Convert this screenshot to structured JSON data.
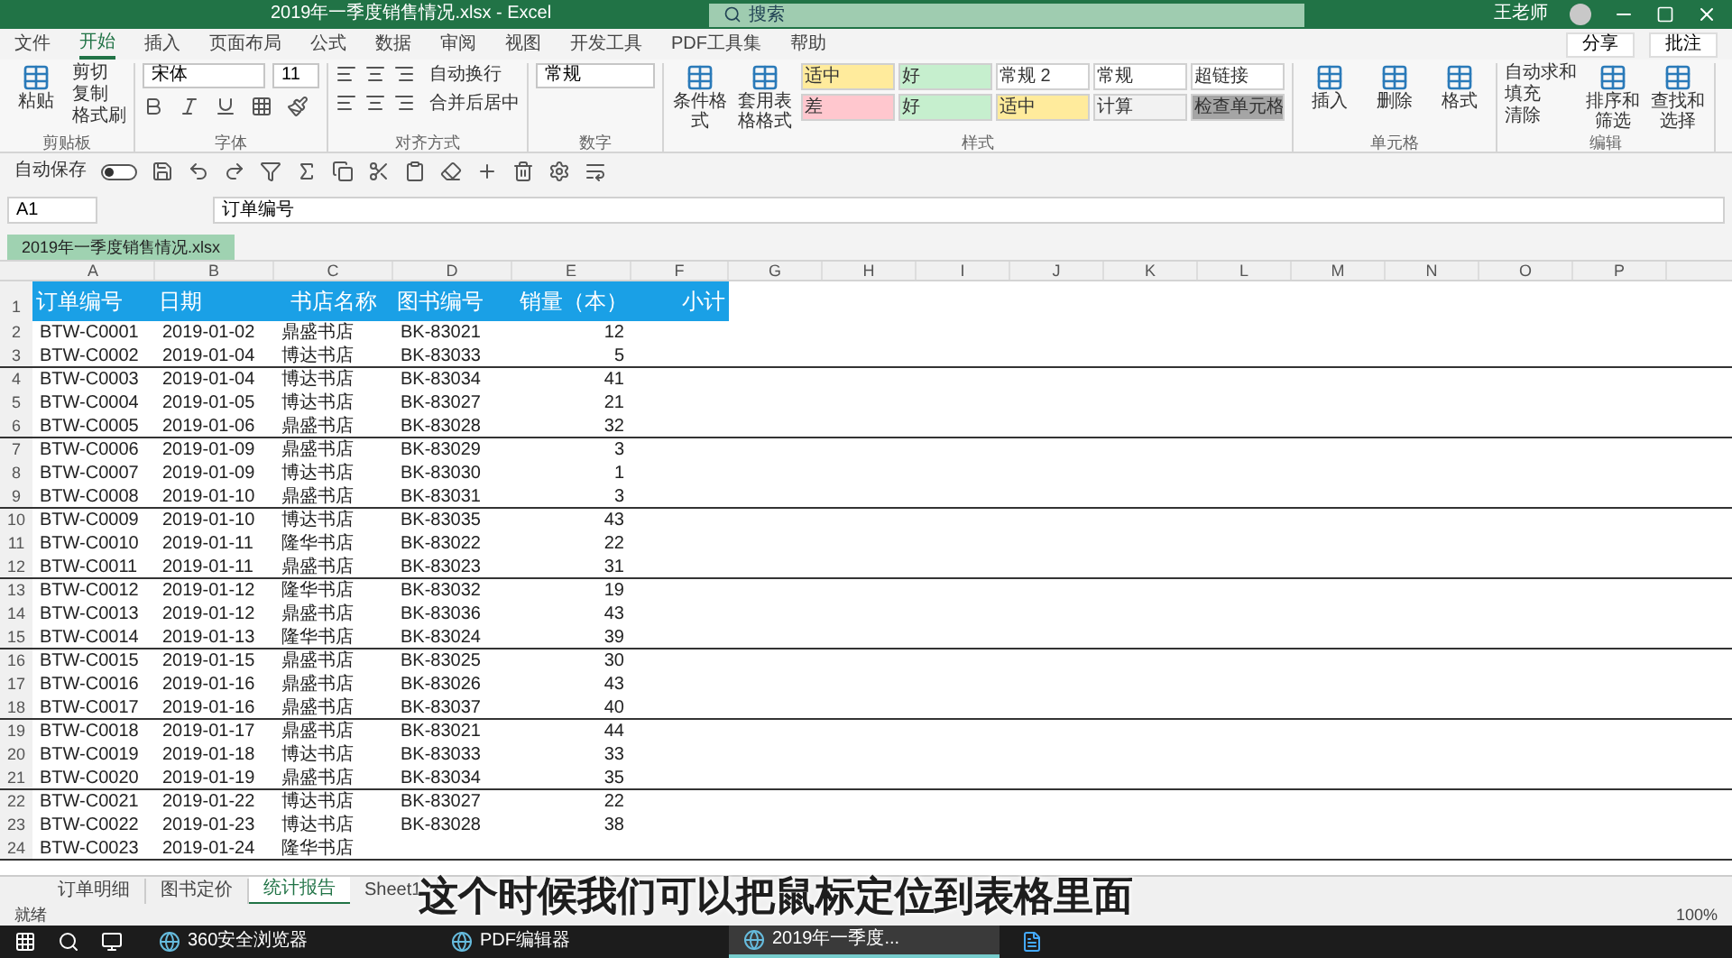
{
  "window": {
    "title": "2019年一季度销售情况.xlsx - Excel",
    "search_placeholder": "搜索",
    "user": "王老师"
  },
  "menu_tabs": [
    {
      "label": "文件",
      "selected": false
    },
    {
      "label": "开始",
      "selected": true
    },
    {
      "label": "插入",
      "selected": false
    },
    {
      "label": "页面布局",
      "selected": false
    },
    {
      "label": "公式",
      "selected": false
    },
    {
      "label": "数据",
      "selected": false
    },
    {
      "label": "审阅",
      "selected": false
    },
    {
      "label": "视图",
      "selected": false
    },
    {
      "label": "开发工具",
      "selected": false
    },
    {
      "label": "PDF工具集",
      "selected": false
    },
    {
      "label": "帮助",
      "selected": false
    }
  ],
  "share_buttons": [
    "分享",
    "批注"
  ],
  "ribbon": [
    {
      "name": "剪贴板",
      "items": [
        {
          "kind": "large",
          "label": "粘贴"
        },
        {
          "kind": "stack",
          "labels": [
            "剪切",
            "复制",
            "格式刷"
          ]
        }
      ]
    },
    {
      "name": "字体",
      "items": [
        {
          "kind": "font",
          "font": "宋体",
          "size": "11"
        }
      ]
    },
    {
      "name": "对齐方式",
      "items": [
        {
          "kind": "align",
          "labels": [
            "自动换行",
            "合并后居中"
          ]
        }
      ]
    },
    {
      "name": "数字",
      "items": [
        {
          "kind": "number",
          "value": "常规"
        }
      ]
    },
    {
      "name": "样式",
      "items": [
        {
          "kind": "large",
          "label": "条件格式"
        },
        {
          "kind": "large",
          "label": "套用表格格式"
        },
        {
          "kind": "styles",
          "cells": [
            {
              "label": "适中",
              "color": "#ffeb9c"
            },
            {
              "label": "好",
              "color": "#c6efce"
            },
            {
              "label": "常规 2",
              "color": "#ffffff"
            },
            {
              "label": "常规",
              "color": "#ffffff"
            },
            {
              "label": "超链接",
              "color": "#ffffff"
            },
            {
              "label": "差",
              "color": "#ffc7ce"
            },
            {
              "label": "好",
              "color": "#c6efce"
            },
            {
              "label": "适中",
              "color": "#ffeb9c"
            },
            {
              "label": "计算",
              "color": "#f2f2f2"
            },
            {
              "label": "检查单元格",
              "color": "#a5a5a5"
            }
          ]
        }
      ]
    },
    {
      "name": "单元格",
      "items": [
        {
          "kind": "large",
          "label": "插入"
        },
        {
          "kind": "large",
          "label": "删除"
        },
        {
          "kind": "large",
          "label": "格式"
        }
      ]
    },
    {
      "name": "编辑",
      "items": [
        {
          "kind": "stack",
          "labels": [
            "自动求和",
            "填充",
            "清除"
          ]
        },
        {
          "kind": "large",
          "label": "排序和筛选"
        },
        {
          "kind": "large",
          "label": "查找和选择"
        }
      ]
    }
  ],
  "quick_toolbar": {
    "label": "自动保存",
    "on": false
  },
  "formula_bar": {
    "name_box": "A1",
    "value": "订单编号"
  },
  "workbook_tab": "2019年一季度销售情况.xlsx",
  "columns": [
    "A",
    "B",
    "C",
    "D",
    "E",
    "F",
    "G",
    "H",
    "I",
    "J",
    "K",
    "L",
    "M",
    "N",
    "O",
    "P"
  ],
  "table": {
    "header_row": "1",
    "header": [
      "订单编号",
      "日期",
      "书店名称",
      "图书编号",
      "销量（本）",
      "小计"
    ],
    "rows": [
      {
        "row": "2",
        "cells": [
          "BTW-C0001",
          "2019-01-02",
          "鼎盛书店",
          "BK-83021",
          "12"
        ]
      },
      {
        "row": "3",
        "cells": [
          "BTW-C0002",
          "2019-01-04",
          "博达书店",
          "BK-83033",
          "5"
        ]
      },
      {
        "row": "4",
        "cells": [
          "BTW-C0003",
          "2019-01-04",
          "博达书店",
          "BK-83034",
          "41"
        ]
      },
      {
        "row": "5",
        "cells": [
          "BTW-C0004",
          "2019-01-05",
          "博达书店",
          "BK-83027",
          "21"
        ]
      },
      {
        "row": "6",
        "cells": [
          "BTW-C0005",
          "2019-01-06",
          "鼎盛书店",
          "BK-83028",
          "32"
        ]
      },
      {
        "row": "7",
        "cells": [
          "BTW-C0006",
          "2019-01-09",
          "鼎盛书店",
          "BK-83029",
          "3"
        ]
      },
      {
        "row": "8",
        "cells": [
          "BTW-C0007",
          "2019-01-09",
          "博达书店",
          "BK-83030",
          "1"
        ]
      },
      {
        "row": "9",
        "cells": [
          "BTW-C0008",
          "2019-01-10",
          "鼎盛书店",
          "BK-83031",
          "3"
        ]
      },
      {
        "row": "10",
        "cells": [
          "BTW-C0009",
          "2019-01-10",
          "博达书店",
          "BK-83035",
          "43"
        ]
      },
      {
        "row": "11",
        "cells": [
          "BTW-C0010",
          "2019-01-11",
          "隆华书店",
          "BK-83022",
          "22"
        ]
      },
      {
        "row": "12",
        "cells": [
          "BTW-C0011",
          "2019-01-11",
          "鼎盛书店",
          "BK-83023",
          "31"
        ]
      },
      {
        "row": "13",
        "cells": [
          "BTW-C0012",
          "2019-01-12",
          "隆华书店",
          "BK-83032",
          "19"
        ]
      },
      {
        "row": "14",
        "cells": [
          "BTW-C0013",
          "2019-01-12",
          "鼎盛书店",
          "BK-83036",
          "43"
        ]
      },
      {
        "row": "15",
        "cells": [
          "BTW-C0014",
          "2019-01-13",
          "隆华书店",
          "BK-83024",
          "39"
        ]
      },
      {
        "row": "16",
        "cells": [
          "BTW-C0015",
          "2019-01-15",
          "鼎盛书店",
          "BK-83025",
          "30"
        ]
      },
      {
        "row": "17",
        "cells": [
          "BTW-C0016",
          "2019-01-16",
          "鼎盛书店",
          "BK-83026",
          "43"
        ]
      },
      {
        "row": "18",
        "cells": [
          "BTW-C0017",
          "2019-01-16",
          "鼎盛书店",
          "BK-83037",
          "40"
        ]
      },
      {
        "row": "19",
        "cells": [
          "BTW-C0018",
          "2019-01-17",
          "鼎盛书店",
          "BK-83021",
          "44"
        ]
      },
      {
        "row": "20",
        "cells": [
          "BTW-C0019",
          "2019-01-18",
          "博达书店",
          "BK-83033",
          "33"
        ]
      },
      {
        "row": "21",
        "cells": [
          "BTW-C0020",
          "2019-01-19",
          "鼎盛书店",
          "BK-83034",
          "35"
        ]
      },
      {
        "row": "22",
        "cells": [
          "BTW-C0021",
          "2019-01-22",
          "博达书店",
          "BK-83027",
          "22"
        ]
      },
      {
        "row": "23",
        "cells": [
          "BTW-C0022",
          "2019-01-23",
          "博达书店",
          "BK-83028",
          "38"
        ]
      },
      {
        "row": "24",
        "cells": [
          "BTW-C0023",
          "2019-01-24",
          "隆华书店"
        ]
      }
    ]
  },
  "sheet_tabs": [
    {
      "label": "订单明细",
      "selected": false
    },
    {
      "label": "图书定价",
      "selected": false
    },
    {
      "label": "统计报告",
      "selected": true
    },
    {
      "label": "Sheet1",
      "selected": false
    }
  ],
  "status_bar": {
    "text": "就绪",
    "zoom": "100%"
  },
  "subtitle": "这个时候我们可以把鼠标定位到表格里面",
  "taskbar": [
    {
      "label": "360安全浏览器",
      "selected": false
    },
    {
      "label": "PDF编辑器",
      "selected": false
    },
    {
      "label": "2019年一季度...",
      "selected": true
    }
  ]
}
